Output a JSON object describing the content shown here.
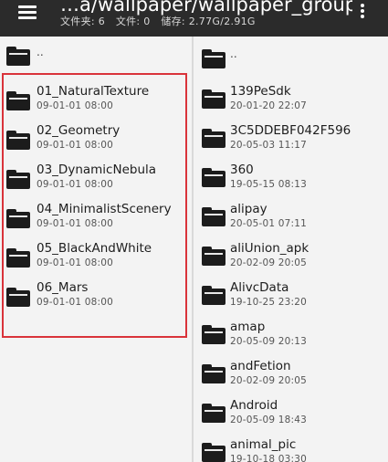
{
  "header": {
    "path": "…a/wallpaper/wallpaper_group/",
    "folders_label": "文件夹: 6",
    "files_label": "文件: 0",
    "storage_label": "储存: 2.77G/2.91G"
  },
  "left_pane": {
    "up_label": "..",
    "items": [
      {
        "name": "01_NaturalTexture",
        "date": "09-01-01 08:00"
      },
      {
        "name": "02_Geometry",
        "date": "09-01-01 08:00"
      },
      {
        "name": "03_DynamicNebula",
        "date": "09-01-01 08:00"
      },
      {
        "name": "04_MinimalistScenery",
        "date": "09-01-01 08:00"
      },
      {
        "name": "05_BlackAndWhite",
        "date": "09-01-01 08:00"
      },
      {
        "name": "06_Mars",
        "date": "09-01-01 08:00"
      }
    ]
  },
  "right_pane": {
    "up_label": "..",
    "items": [
      {
        "name": "139PeSdk",
        "date": "20-01-20 22:07"
      },
      {
        "name": "3C5DDEBF042F596",
        "date": "20-05-03 11:17"
      },
      {
        "name": "360",
        "date": "19-05-15 08:13"
      },
      {
        "name": "alipay",
        "date": "20-05-01 07:11"
      },
      {
        "name": "aliUnion_apk",
        "date": "20-02-09 20:05"
      },
      {
        "name": "AlivcData",
        "date": "19-10-25 23:20"
      },
      {
        "name": "amap",
        "date": "20-05-09 20:13"
      },
      {
        "name": "andFetion",
        "date": "20-02-09 20:05"
      },
      {
        "name": "Android",
        "date": "20-05-09 18:43"
      },
      {
        "name": "animal_pic",
        "date": "19-10-18 03:30"
      }
    ]
  },
  "colors": {
    "topbar": "#2b2b2b",
    "highlight_border": "#d9333a",
    "folder_icon": "#1c1c1c"
  }
}
